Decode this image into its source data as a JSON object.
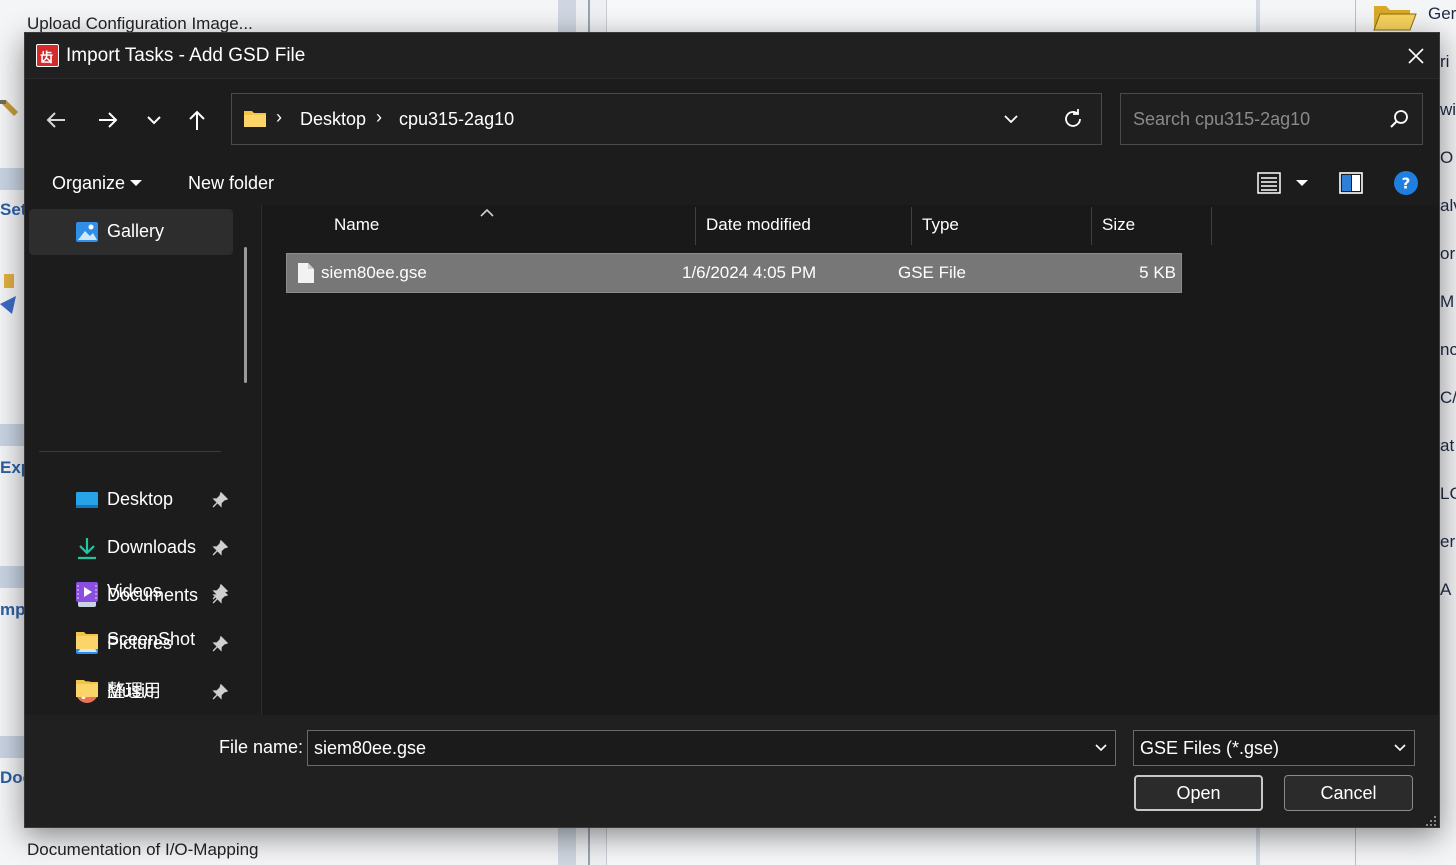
{
  "background": {
    "top_left_text": "Upload Configuration Image...",
    "bottom_left_text": "Documentation of I/O-Mapping",
    "left_edge_fragments": [
      "Set",
      "Exp",
      "mp",
      "Doc"
    ],
    "right_edge_fragments": [
      "Ger",
      "ri",
      "wi",
      "O",
      "alv",
      "or",
      "M",
      "nc",
      "C/",
      "at",
      "LC",
      "er",
      "A"
    ]
  },
  "dialog": {
    "title": "Import Tasks - Add GSD File",
    "app_icon_glyph": "齿",
    "address": {
      "crumbs": [
        "Desktop",
        "cpu315-2ag10"
      ],
      "separator": "›"
    },
    "search_placeholder": "Search cpu315-2ag10",
    "toolbar": {
      "organize_label": "Organize",
      "new_folder_label": "New folder"
    },
    "nav_items": [
      {
        "label": "Gallery",
        "icon": "gallery-icon",
        "pinned": false,
        "selected": true
      },
      {
        "label": "Desktop",
        "icon": "desktop-icon",
        "pinned": true
      },
      {
        "label": "Downloads",
        "icon": "downloads-icon",
        "pinned": true
      },
      {
        "label": "Documents",
        "icon": "documents-icon",
        "pinned": true
      },
      {
        "label": "Pictures",
        "icon": "pictures-icon",
        "pinned": true
      },
      {
        "label": "Music",
        "icon": "music-icon",
        "pinned": true
      },
      {
        "label": "Videos",
        "icon": "videos-icon",
        "pinned": true
      },
      {
        "label": "SceenShot",
        "icon": "folder-icon",
        "pinned": false
      },
      {
        "label": "整理用",
        "icon": "folder-icon",
        "pinned": false
      },
      {
        "label": "gsdml",
        "icon": "folder-icon",
        "pinned": false
      }
    ],
    "columns": [
      "Name",
      "Date modified",
      "Type",
      "Size"
    ],
    "files": [
      {
        "name": "siem80ee.gse",
        "date_modified": "1/6/2024 4:05 PM",
        "type": "GSE File",
        "size": "5 KB",
        "selected": true
      }
    ],
    "file_name_label": "File name:",
    "file_name_value": "siem80ee.gse",
    "file_type_value": "GSE Files (*.gse)",
    "open_label": "Open",
    "cancel_label": "Cancel"
  },
  "colors": {
    "dialog_bg": "#1c1c1c",
    "selected_row": "#777777",
    "folder_yellow": "#f6c445",
    "help_blue": "#1e7fe0"
  }
}
